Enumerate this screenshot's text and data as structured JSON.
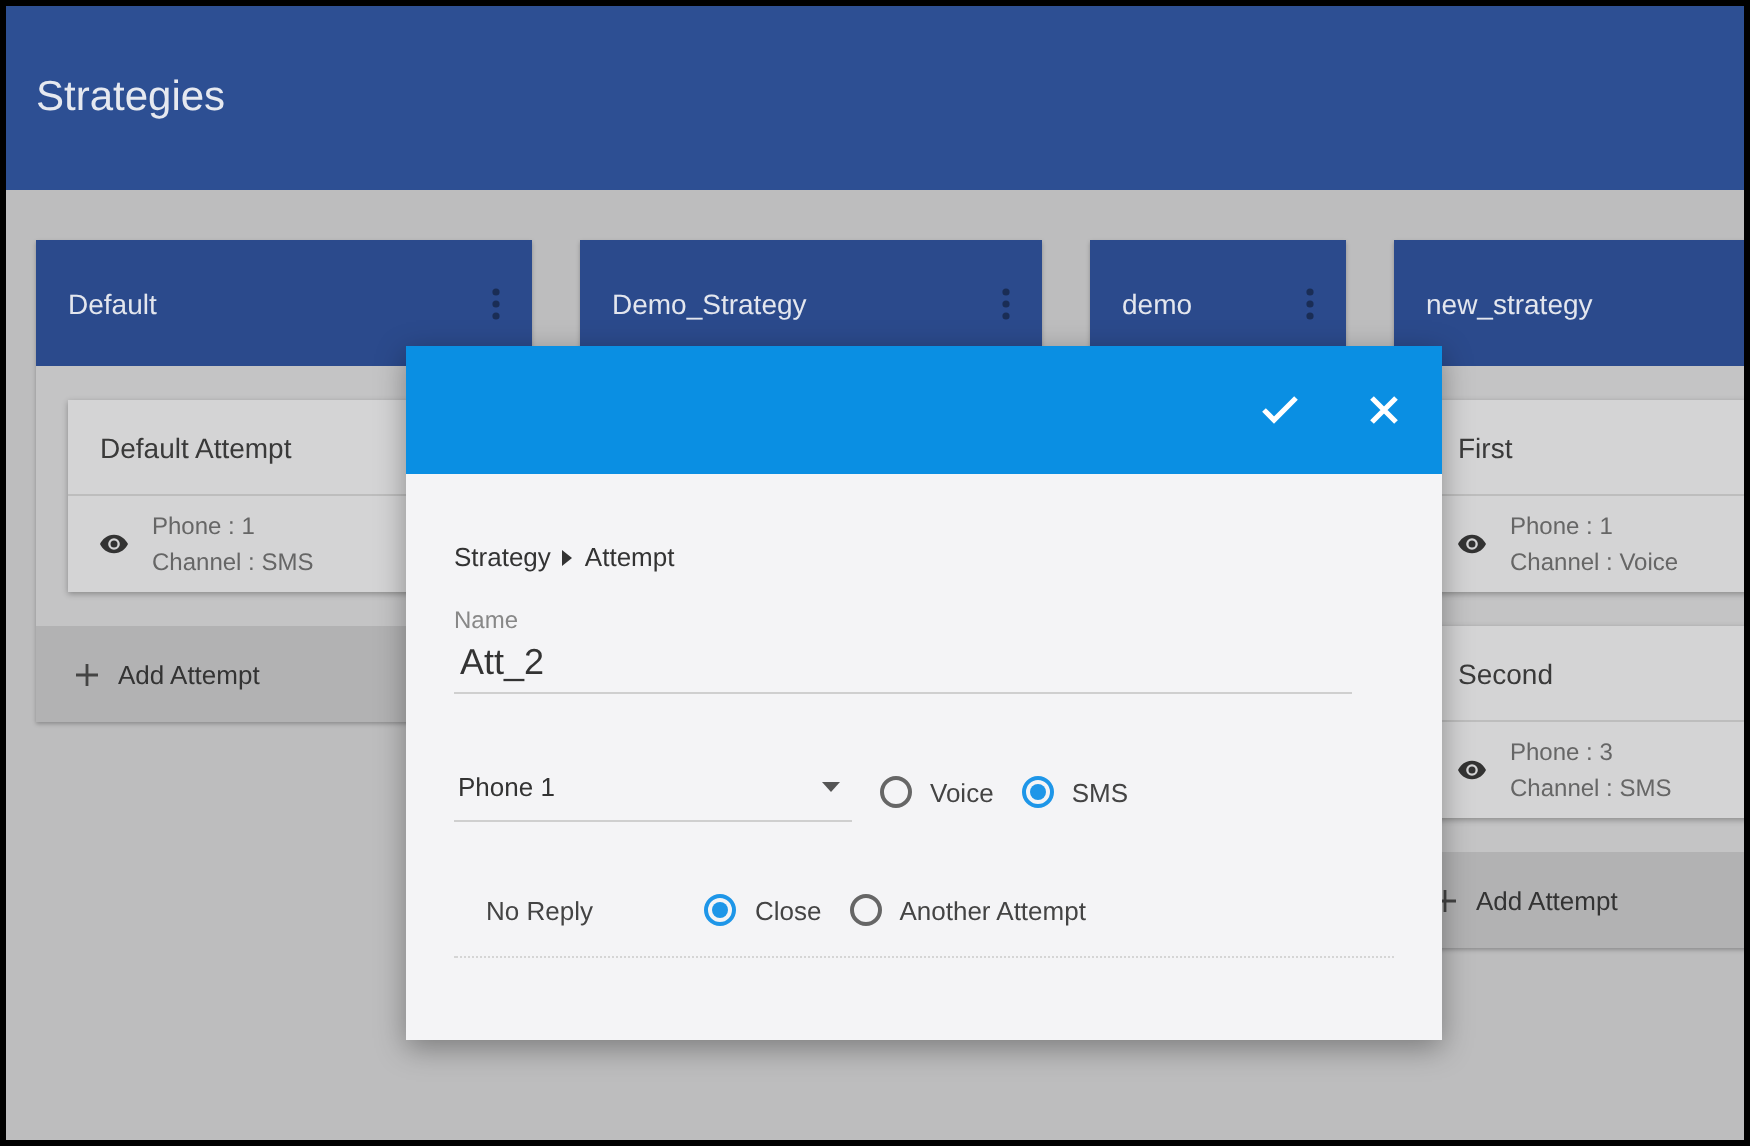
{
  "header": {
    "title": "Strategies"
  },
  "columns": [
    {
      "title": "Default",
      "attempts": [
        {
          "name": "Default Attempt",
          "phone": "Phone : 1",
          "channel": "Channel : SMS"
        }
      ],
      "add_label": "Add Attempt"
    },
    {
      "title": "Demo_Strategy"
    },
    {
      "title": "demo"
    },
    {
      "title": "new_strategy",
      "attempts": [
        {
          "name": "First",
          "phone": "Phone : 1",
          "channel": "Channel : Voice"
        },
        {
          "name": "Second",
          "phone": "Phone : 3",
          "channel": "Channel : SMS"
        }
      ],
      "add_label": "Add Attempt"
    }
  ],
  "dialog": {
    "breadcrumb": [
      "Strategy",
      "Attempt"
    ],
    "name_field": {
      "label": "Name",
      "value": "Att_2"
    },
    "phone_select": {
      "value": "Phone 1"
    },
    "channel_options": [
      {
        "label": "Voice",
        "selected": false
      },
      {
        "label": "SMS",
        "selected": true
      }
    ],
    "no_reply": {
      "label": "No Reply",
      "options": [
        {
          "label": "Close",
          "selected": true
        },
        {
          "label": "Another Attempt",
          "selected": false
        }
      ]
    }
  }
}
